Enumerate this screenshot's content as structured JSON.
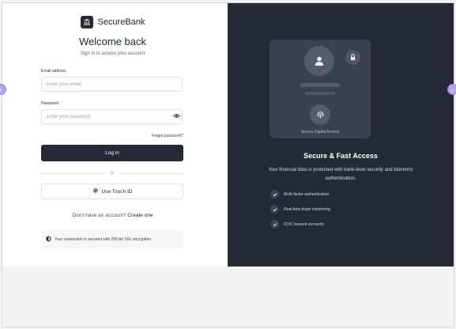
{
  "brand": {
    "name": "SecureBank",
    "logo_icon": "bank-icon"
  },
  "login": {
    "title": "Welcome back",
    "subtitle": "Sign in to access your account",
    "email_label": "Email address",
    "email_placeholder": "Enter your email",
    "email_value": "",
    "password_label": "Password",
    "password_placeholder": "Enter your password",
    "password_value": "",
    "forgot_label": "Forgot password?",
    "login_button": "Log in",
    "divider_text": "or",
    "touch_id_button": "Use Touch ID",
    "signup_prompt": "Don't have an account?",
    "signup_link": "Create one",
    "ssl_notice": "Your connection is secured with 256-bit SSL encryption"
  },
  "promo": {
    "card_label": "Secure Digital Access",
    "title": "Secure & Fast Access",
    "description": "Your financial data is protected with bank-level security and biometric authentication.",
    "features": [
      "Multi-factor authentication",
      "Real-time fraud monitoring",
      "FDIC insured accounts"
    ]
  },
  "colors": {
    "primary_dark": "#232a36",
    "card": "#3a4150",
    "accent_handle": "#b7a0f0"
  }
}
